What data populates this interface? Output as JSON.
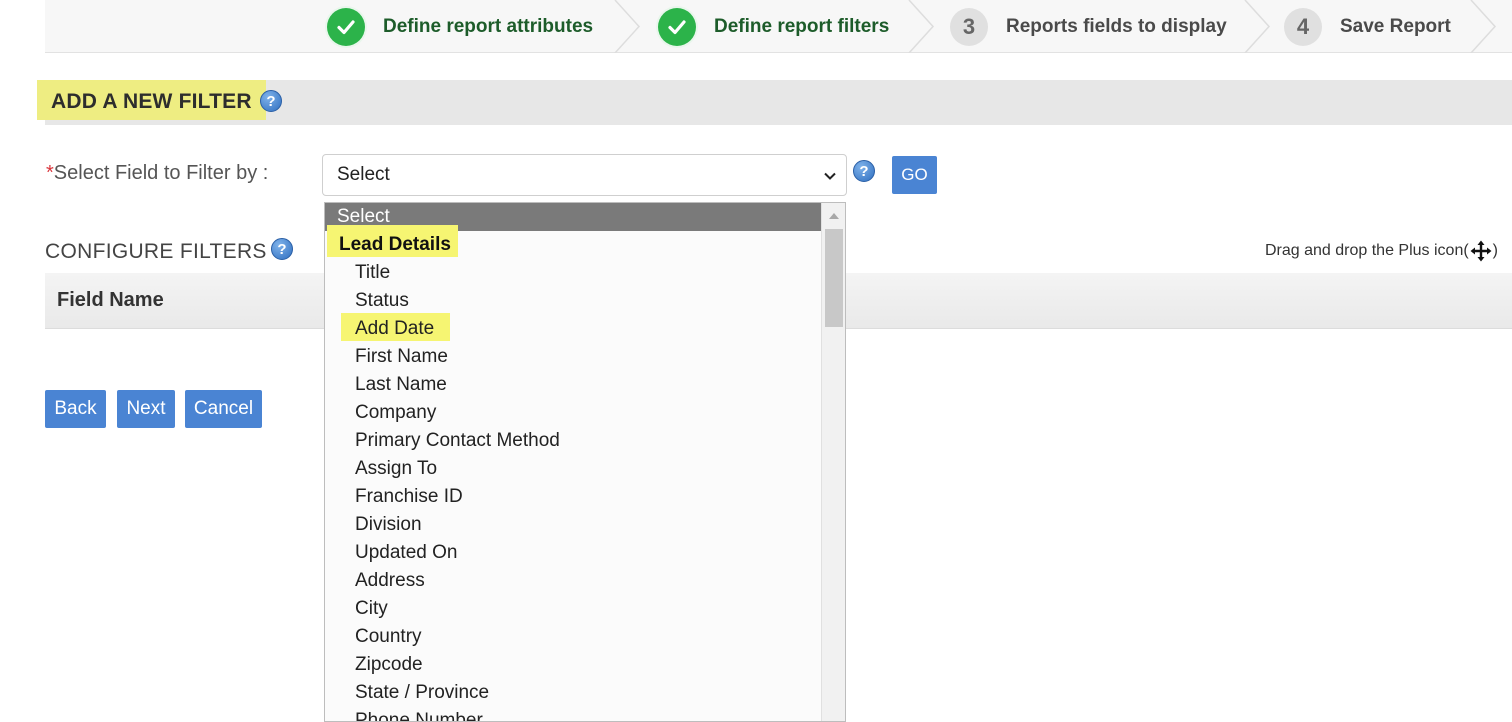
{
  "wizard": {
    "steps": [
      {
        "label": "Define report attributes",
        "state": "done"
      },
      {
        "label": "Define report filters",
        "state": "done"
      },
      {
        "number": "3",
        "label": "Reports fields to display",
        "state": "todo"
      },
      {
        "number": "4",
        "label": "Save Report",
        "state": "todo"
      }
    ]
  },
  "add_filter": {
    "title": "ADD A NEW FILTER",
    "field_label_required": "*",
    "field_label": "Select Field to Filter by :",
    "select_value": "Select",
    "go_label": "GO"
  },
  "configure": {
    "title": "CONFIGURE FILTERS",
    "drag_hint_prefix": "Drag and drop the Plus icon(",
    "drag_hint_suffix": ")",
    "column_field_name": "Field Name"
  },
  "buttons": {
    "back": "Back",
    "next": "Next",
    "cancel": "Cancel"
  },
  "dropdown": {
    "selected": "Select",
    "group": "Lead Details",
    "options": [
      "Title",
      "Status",
      "Add Date",
      "First Name",
      "Last Name",
      "Company",
      "Primary Contact Method",
      "Assign To",
      "Franchise ID",
      "Division",
      "Updated On",
      "Address",
      "City",
      "Country",
      "Zipcode",
      "State / Province",
      "Phone Number"
    ]
  },
  "colors": {
    "accent_button": "#4a84d3",
    "step_done": "#2cb34a",
    "highlight": "#f6f572"
  },
  "icons": {
    "step_done": "check-circle-icon",
    "help": "question-circle-icon",
    "select_caret": "chevron-down-icon",
    "move": "move-arrows-icon"
  }
}
